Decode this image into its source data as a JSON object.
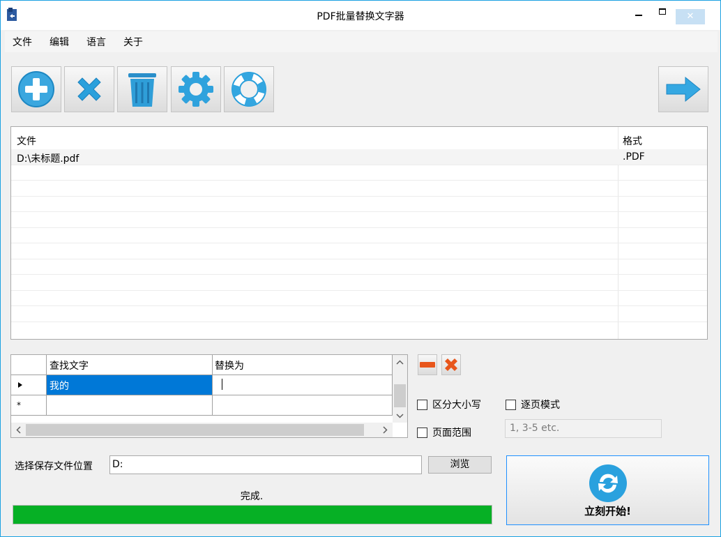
{
  "window": {
    "title": "PDF批量替换文字器",
    "close_glyph": "✕"
  },
  "menu": {
    "items": [
      "文件",
      "编辑",
      "语言",
      "关于"
    ]
  },
  "toolbar": {
    "buttons": [
      "add-icon",
      "remove-icon",
      "trash-icon",
      "settings-icon",
      "help-lifebuoy-icon",
      "next-arrow-icon"
    ]
  },
  "file_list": {
    "columns": [
      "文件",
      "格式"
    ],
    "rows": [
      {
        "file": "D:\\未标题.pdf",
        "format": ".PDF"
      }
    ]
  },
  "replace_grid": {
    "columns": [
      "查找文字",
      "替换为"
    ],
    "rows": [
      {
        "find": "我的",
        "replace": ""
      }
    ],
    "new_row_marker": "*"
  },
  "options": {
    "case_sensitive": "区分大小写",
    "page_by_page": "逐页模式",
    "page_range": "页面范围",
    "page_range_placeholder": "1, 3-5 etc."
  },
  "output": {
    "label": "选择保存文件位置",
    "path": "D:",
    "browse_label": "浏览"
  },
  "status": {
    "text": "完成.",
    "progress_percent": 100
  },
  "start": {
    "label": "立刻开始!"
  },
  "colors": {
    "accent": "#1ba1e2",
    "progress": "#06b025",
    "selection": "#0078d7"
  }
}
